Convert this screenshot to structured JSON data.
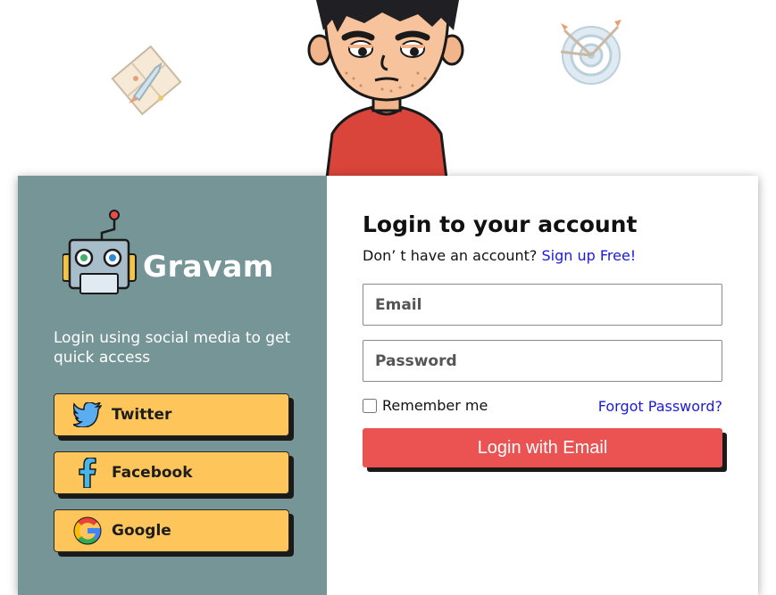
{
  "brand": {
    "name": "Gravam"
  },
  "left_panel": {
    "intro": "Login using social media to get quick access",
    "social_buttons": [
      {
        "label": "Twitter",
        "icon": "twitter-bird-icon"
      },
      {
        "label": "Facebook",
        "icon": "facebook-f-icon"
      },
      {
        "label": "Google",
        "icon": "google-g-icon"
      }
    ]
  },
  "form": {
    "title": "Login to your account",
    "no_account_text": "Don’ t have an account?",
    "signup_link": "Sign up Free!",
    "email_placeholder": "Email",
    "password_placeholder": "Password",
    "remember_label": "Remember me",
    "remember_checked": false,
    "forgot_link": "Forgot Password?",
    "submit_label": "Login with Email"
  },
  "colors": {
    "left_panel_bg": "#769597",
    "social_button_bg": "#fec65a",
    "submit_button_bg": "#eb5252",
    "link": "#1a1adb"
  }
}
